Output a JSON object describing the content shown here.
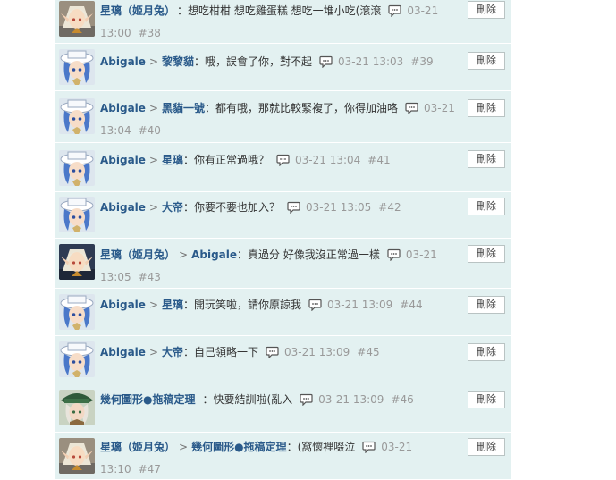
{
  "comments": [
    {
      "avatar": "elf-girl-avatar",
      "author": "星璃（姬月兔）",
      "reply_to": "",
      "text": "：想吃柑柑 想吃雞蛋糕 想吃一堆小吃(滾滾",
      "time": "03-21 13:00",
      "floor": "#38",
      "delete_label": "刪除"
    },
    {
      "avatar": "white-hat-girl-avatar",
      "author": "Abigale",
      "reply_to": "黎黎貓",
      "text": "：哦，誤會了你，對不起",
      "time": "03-21 13:03",
      "floor": "#39",
      "delete_label": "刪除"
    },
    {
      "avatar": "white-hat-girl-avatar",
      "author": "Abigale",
      "reply_to": "黑貓一號",
      "text": "：都有哦，那就比較緊複了，你得加油咯",
      "time": "03-21 13:04",
      "floor": "#40",
      "delete_label": "刪除"
    },
    {
      "avatar": "white-hat-girl-avatar",
      "author": "Abigale",
      "reply_to": "星璃",
      "text": "：你有正常過哦？",
      "time": "03-21 13:04",
      "floor": "#41",
      "delete_label": "刪除"
    },
    {
      "avatar": "white-hat-girl-avatar",
      "author": "Abigale",
      "reply_to": "大帝",
      "text": "：你要不要也加入？",
      "time": "03-21 13:05",
      "floor": "#42",
      "delete_label": "刪除"
    },
    {
      "avatar": "elf-girl-avatar",
      "author": "星璃（姬月兔）",
      "reply_to": "Abigale",
      "text": "：真過分 好像我沒正常過一樣",
      "time": "03-21 13:05",
      "floor": "#43",
      "delete_label": "刪除"
    },
    {
      "avatar": "white-hat-girl-avatar",
      "author": "Abigale",
      "reply_to": "星璃",
      "text": "：開玩笑啦，請你原諒我",
      "time": "03-21 13:09",
      "floor": "#44",
      "delete_label": "刪除"
    },
    {
      "avatar": "white-hat-girl-avatar",
      "author": "Abigale",
      "reply_to": "大帝",
      "text": "：自己領略一下",
      "time": "03-21 13:09",
      "floor": "#45",
      "delete_label": "刪除"
    },
    {
      "avatar": "green-hat-boy-avatar",
      "author": "幾何圖形●拖稿定理",
      "reply_to": "",
      "text": "：快要結訓啦(亂入",
      "time": "03-21 13:09",
      "floor": "#46",
      "delete_label": "刪除"
    },
    {
      "avatar": "elf-girl-avatar",
      "author": "星璃（姬月兔）",
      "reply_to": "幾何圖形●拖稿定理",
      "text": "：(窩懷裡啜泣",
      "time": "03-21 13:10",
      "floor": "#47",
      "delete_label": "刪除"
    }
  ]
}
